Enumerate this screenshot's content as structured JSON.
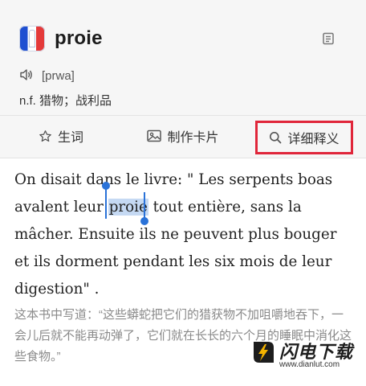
{
  "entry": {
    "app_icon": "eiffel-tower-flag-icon",
    "word": "proie",
    "phonetic": "[prwa]",
    "pos_definition": "n.f. 猎物；战利品",
    "side_icon": "notebook-icon"
  },
  "actions": [
    {
      "label": "生词",
      "icon": "star-icon"
    },
    {
      "label": "制作卡片",
      "icon": "image-card-icon"
    },
    {
      "label": "详细释义",
      "icon": "search-icon"
    }
  ],
  "highlight_color": "#e0263a",
  "example": {
    "before": "On disait dans le livre: \" Les serpents boas avalent leur ",
    "selected": "proie",
    "after": " tout entière, sans la mâcher. Ensuite ils ne peuvent plus bouger et ils dorment pendant les six mois de leur digestion\" .",
    "translation": "这本书中写道：“这些蟒蛇把它们的猎获物不加咀嚼地吞下，一会儿后就不能再动弹了，它们就在长长的六个月的睡眠中消化这些食物。”"
  },
  "watermark": {
    "title": "闪电下载",
    "url": "www.dianlut.com"
  }
}
